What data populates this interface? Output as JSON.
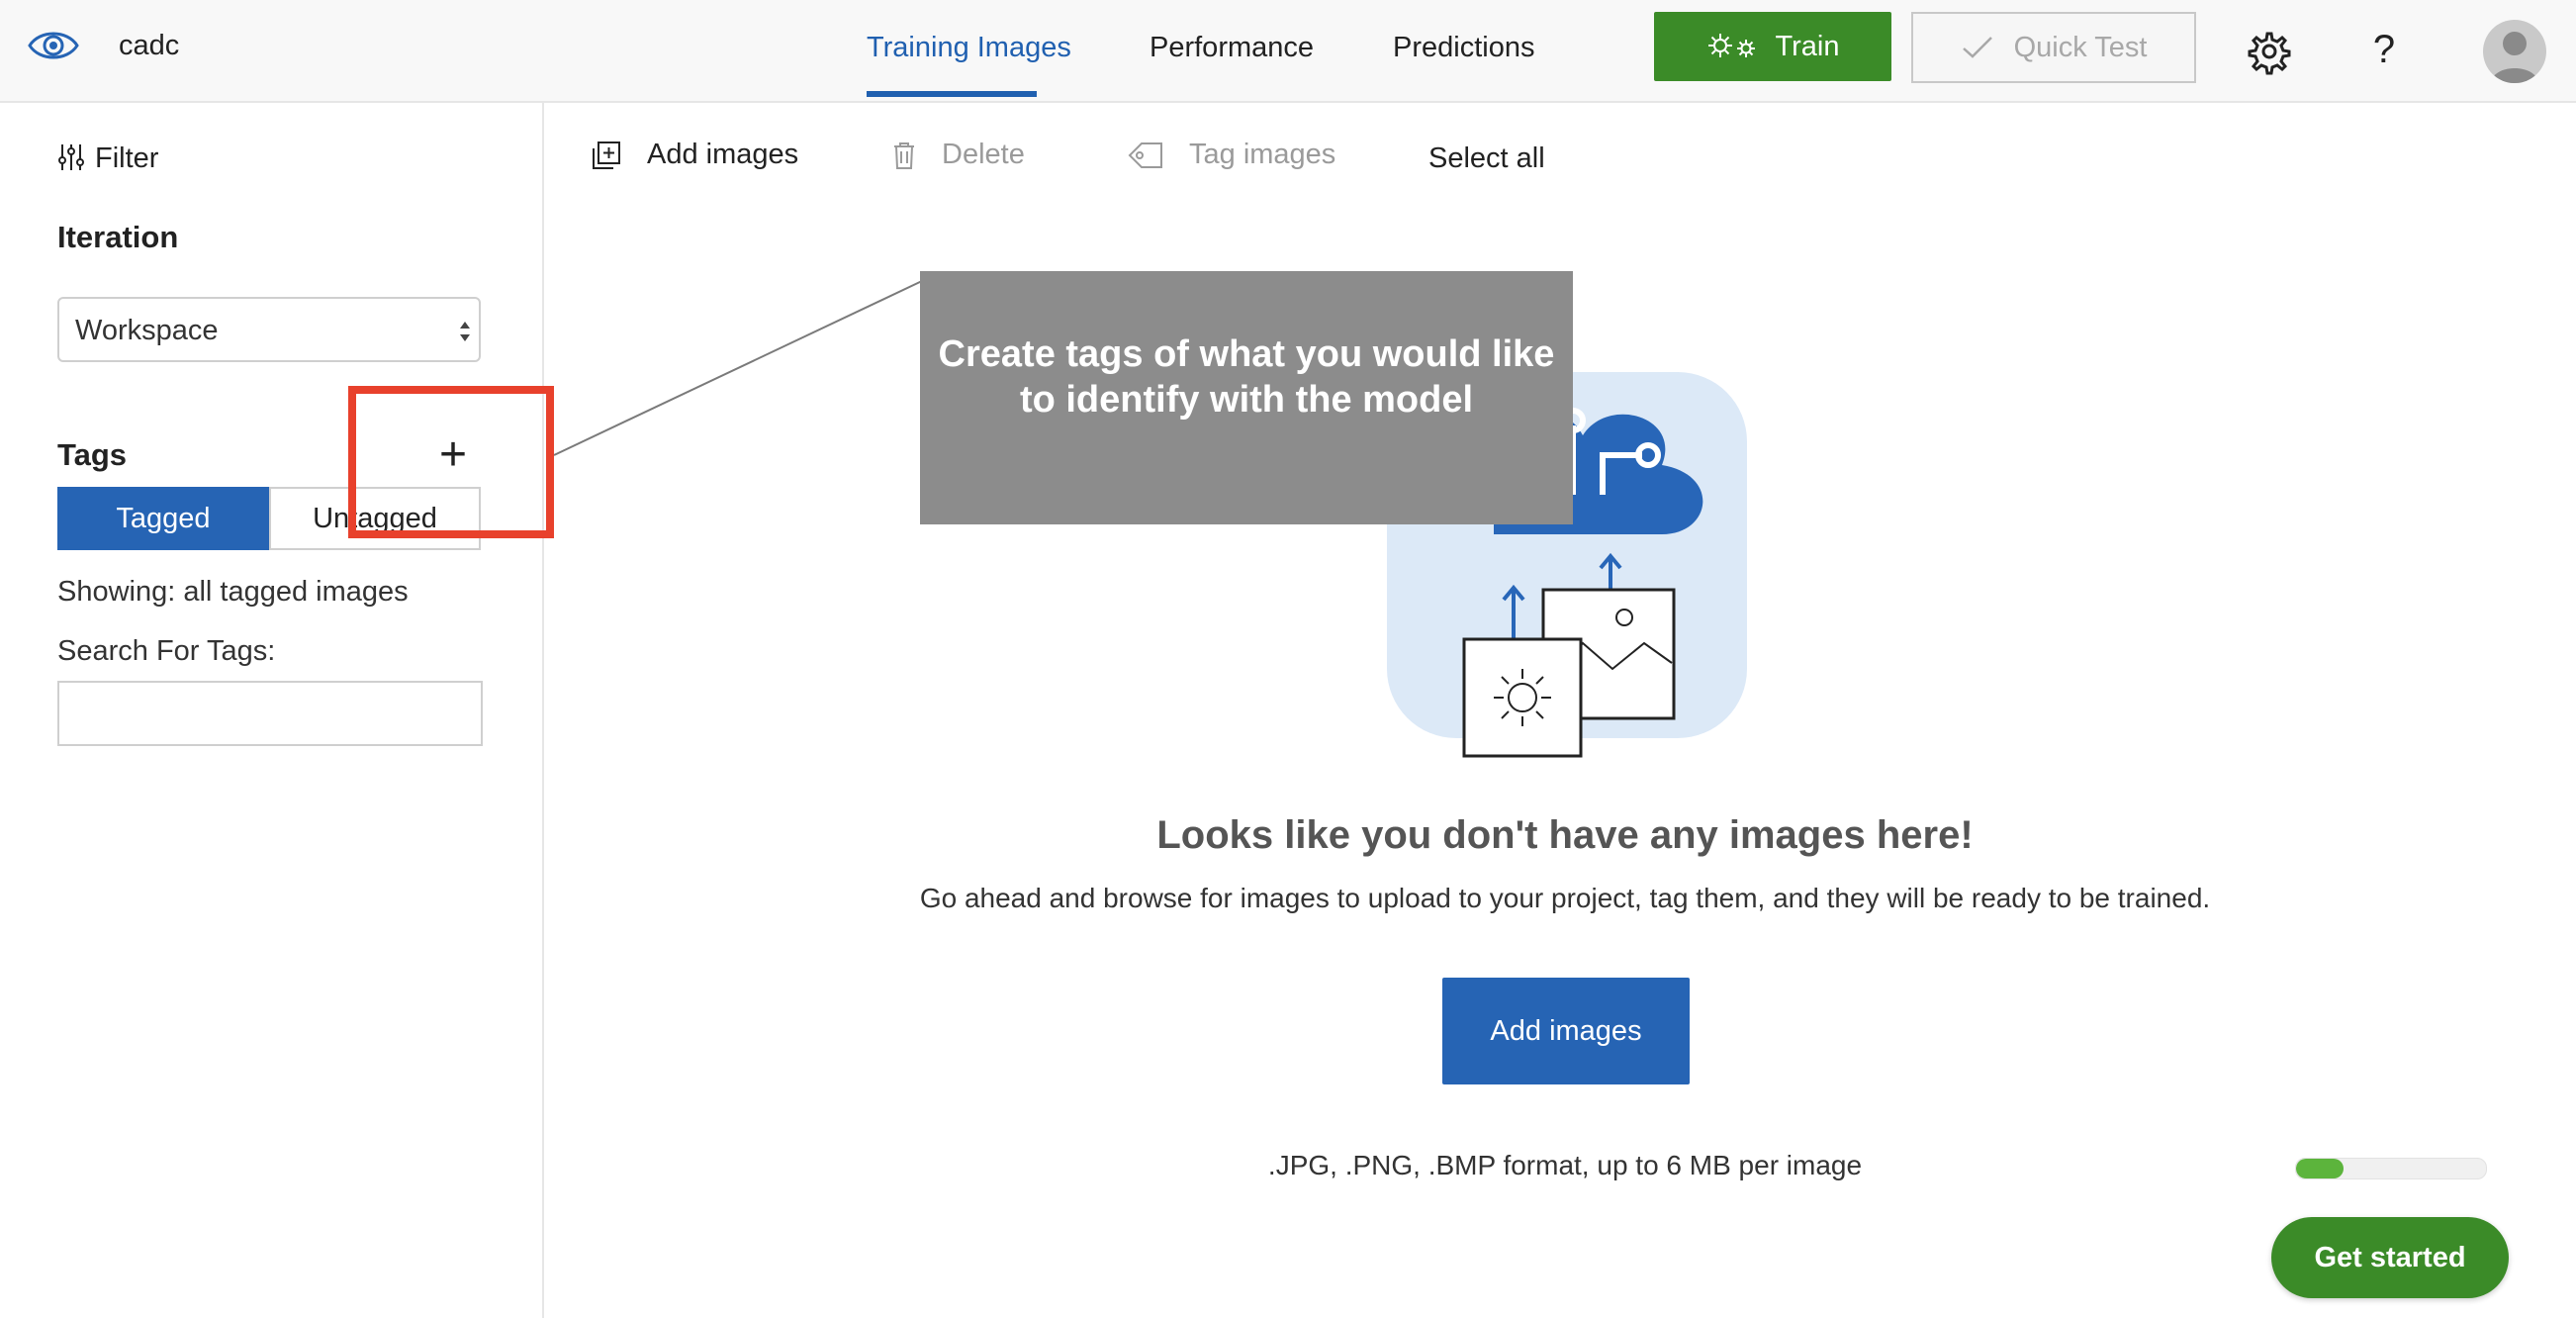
{
  "header": {
    "project_name": "cadc",
    "tabs": [
      {
        "label": "Training Images",
        "active": true
      },
      {
        "label": "Performance",
        "active": false
      },
      {
        "label": "Predictions",
        "active": false
      }
    ],
    "train_label": "Train",
    "quick_test_label": "Quick Test",
    "help_label": "?"
  },
  "sidebar": {
    "filter_label": "Filter",
    "iteration_heading": "Iteration",
    "iteration_value": "Workspace",
    "tags_heading": "Tags",
    "add_tag_label": "+",
    "tagged_label": "Tagged",
    "untagged_label": "Untagged",
    "showing_text": "Showing: all tagged images",
    "search_label": "Search For Tags:",
    "search_value": ""
  },
  "toolbar": {
    "add_images": "Add images",
    "delete": "Delete",
    "tag_images": "Tag images",
    "select_all": "Select all"
  },
  "empty_state": {
    "title": "Looks like you don't have any images here!",
    "description": "Go ahead and browse for images to upload to your project, tag them, and they will be ready to be trained.",
    "button_label": "Add images",
    "format_note": ".JPG, .PNG, .BMP format, up to 6 MB per image"
  },
  "onboarding": {
    "callout_text": "Create tags of what you would like to identify with the model",
    "progress_fraction": 0.25,
    "get_started_label": "Get started"
  },
  "colors": {
    "accent_blue": "#2664b4",
    "train_green": "#3b8b28",
    "highlight_red": "#e8412c",
    "callout_gray": "#8c8c8c"
  }
}
